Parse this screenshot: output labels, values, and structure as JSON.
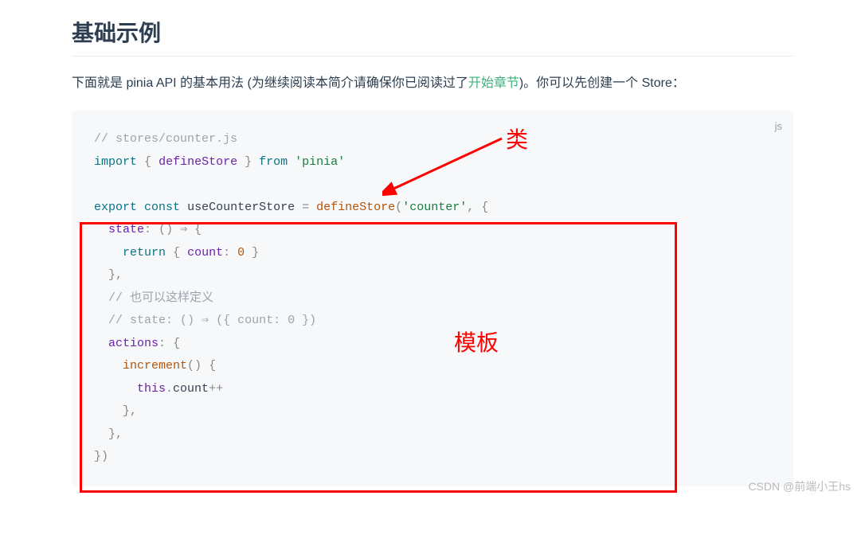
{
  "heading": "基础示例",
  "intro": {
    "part1": "下面就是 pinia API 的基本用法 (为继续阅读本简介请确保你已阅读过了",
    "link": "开始章节",
    "part2": ")。你可以先创建一个 Store："
  },
  "code": {
    "lang": "js",
    "comment1": "// stores/counter.js",
    "kw_import": "import",
    "brace_open": "{",
    "def_defineStore": "defineStore",
    "brace_close": "}",
    "kw_from": "from",
    "str_pinia": "'pinia'",
    "kw_export": "export",
    "kw_const": "const",
    "var_useCounterStore": "useCounterStore",
    "eq": "=",
    "call_defineStore": "defineStore",
    "paren_open": "(",
    "str_counter": "'counter'",
    "comma": ",",
    "obj_open": "{",
    "prop_state": "state",
    "colon": ":",
    "arrow_fn_open": "()",
    "arrow": "⇒",
    "ret_open": "{",
    "kw_return": "return",
    "count_prop": "count",
    "zero": "0",
    "ret_close": "}",
    "state_close": "},",
    "comment2": "// 也可以这样定义",
    "comment3": "// state: () ⇒ ({ count: 0 })",
    "prop_actions": "actions",
    "actions_open": "{",
    "fn_increment": "increment",
    "inc_open": "()",
    "inc_brace": "{",
    "this": "this",
    "dot": ".",
    "count2": "count",
    "plusplus": "++",
    "inc_close": "},",
    "actions_close": "},",
    "obj_close": "})"
  },
  "annotations": {
    "class_label": "类",
    "template_label": "模板"
  },
  "watermark": "CSDN @前端小王hs"
}
